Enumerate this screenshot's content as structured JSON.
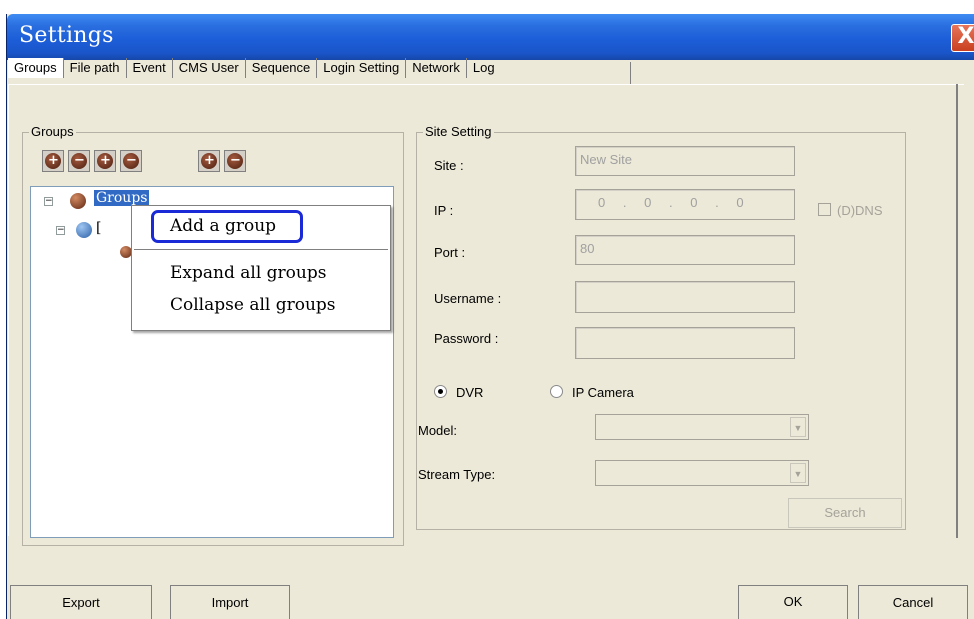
{
  "window": {
    "title": "Settings",
    "close_symbol": "X"
  },
  "tabs": [
    {
      "label": "Groups",
      "active": true
    },
    {
      "label": "File path"
    },
    {
      "label": "Event"
    },
    {
      "label": "CMS User"
    },
    {
      "label": "Sequence"
    },
    {
      "label": "Login Setting"
    },
    {
      "label": "Network"
    },
    {
      "label": "Log"
    }
  ],
  "groups_panel": {
    "label": "Groups",
    "toolbar": [
      {
        "icon": "add-group-icon",
        "glyph": "+"
      },
      {
        "icon": "remove-group-icon",
        "glyph": "−"
      },
      {
        "icon": "add-site-icon",
        "glyph": "+"
      },
      {
        "icon": "remove-site-icon",
        "glyph": "−"
      },
      {
        "icon": "zoom-in-icon",
        "glyph": "+"
      },
      {
        "icon": "zoom-out-icon",
        "glyph": "−"
      }
    ],
    "tree": {
      "root_label": "Groups",
      "child_label": "["
    }
  },
  "context_menu": {
    "items": [
      "Add a group",
      "Expand all groups",
      "Collapse all groups"
    ],
    "highlighted": "Add a group"
  },
  "site_setting": {
    "label": "Site Setting",
    "site_label": "Site :",
    "site_value": "New Site",
    "ip_label": "IP :",
    "ip_octets": [
      "0",
      "0",
      "0",
      "0"
    ],
    "ddns_label": "(D)DNS",
    "port_label": "Port :",
    "port_value": "80",
    "username_label": "Username :",
    "password_label": "Password :",
    "device_types": [
      {
        "label": "DVR",
        "selected": true
      },
      {
        "label": "IP Camera",
        "selected": false
      }
    ],
    "model_label": "Model:",
    "stream_type_label": "Stream Type:",
    "search_label": "Search"
  },
  "footer": {
    "export_label": "Export",
    "import_label": "Import",
    "ok_label": "OK",
    "cancel_label": "Cancel"
  },
  "colors": {
    "title_bar": "#1c5ed8",
    "selection": "#316ac5",
    "highlight_outline": "#1a2ad6",
    "close_button": "#c8401f"
  }
}
